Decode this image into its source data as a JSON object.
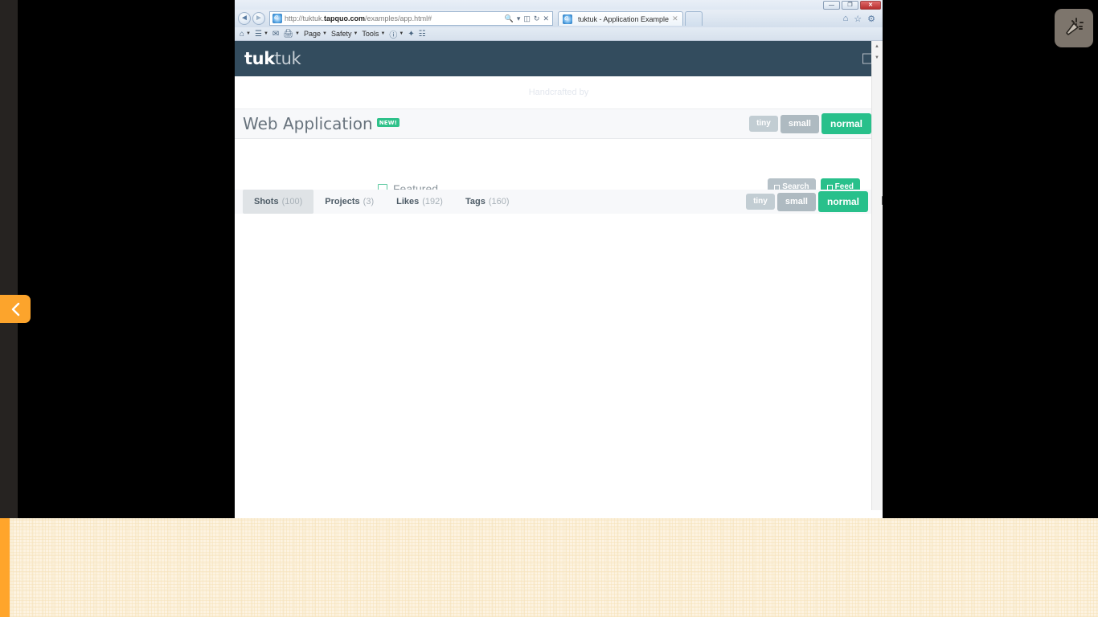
{
  "browser": {
    "window_controls": {
      "minimize": "—",
      "restore": "❐",
      "close": "✕"
    },
    "back_label": "◄",
    "forward_label": "►",
    "address": {
      "scheme": "http://tuktuk.",
      "domain": "tapquo.com",
      "path": "/examples/app.html#"
    },
    "address_icons": [
      "search-icon",
      "compat-view-icon",
      "refresh-icon",
      "stop-icon"
    ],
    "tab_title": "tuktuk - Application Example",
    "tab_close": "✕",
    "new_tab_label": "",
    "chrome_icons": [
      "home-icon",
      "favorites-icon",
      "tools-gear-icon"
    ],
    "command_bar": [
      {
        "icon": "home-icon",
        "label": "",
        "caret": true
      },
      {
        "icon": "feeds-icon",
        "label": "",
        "caret": true
      },
      {
        "icon": "mail-icon",
        "label": "",
        "caret": false
      },
      {
        "icon": "print-icon",
        "label": "",
        "caret": true
      },
      {
        "icon": "",
        "label": "Page",
        "caret": true
      },
      {
        "icon": "",
        "label": "Safety",
        "caret": true
      },
      {
        "icon": "",
        "label": "Tools",
        "caret": true
      },
      {
        "icon": "help-icon",
        "label": "",
        "caret": true
      },
      {
        "icon": "addon-icon",
        "label": "",
        "caret": false
      },
      {
        "icon": "signal-icon",
        "label": "",
        "caret": false
      }
    ]
  },
  "app": {
    "brand": {
      "bold": "tuk",
      "light": "tuk"
    },
    "navbar_toggle": "menu-toggle",
    "handcrafted": "Handcrafted by",
    "title": "Web Application",
    "badge": "NEW!",
    "size_buttons": [
      {
        "label": "tiny",
        "active": false
      },
      {
        "label": "small",
        "active": false
      },
      {
        "label": "normal",
        "active": true
      }
    ],
    "featured": {
      "label": "Featured",
      "checked": false
    },
    "clipped_buttons": [
      {
        "label": "Search",
        "style": "gray"
      },
      {
        "label": "Feed",
        "style": "green"
      }
    ],
    "tabs": [
      {
        "label": "Shots",
        "count": "(100)",
        "active": true
      },
      {
        "label": "Projects",
        "count": "(3)",
        "active": false
      },
      {
        "label": "Likes",
        "count": "(192)",
        "active": false
      },
      {
        "label": "Tags",
        "count": "(160)",
        "active": false
      }
    ],
    "tab_size_buttons": [
      {
        "label": "tiny",
        "active": false
      },
      {
        "label": "small",
        "active": false
      },
      {
        "label": "normal",
        "active": true
      }
    ]
  },
  "desktop": {
    "pull_tab": "chevron-left-icon",
    "tool_widget": "magic-wand-icon"
  },
  "colors": {
    "navbar": "#334c5e",
    "accent_green": "#28c08b",
    "orange": "#fca42c",
    "gray_button": "#c2cdd3",
    "paper": "#fdf3e1"
  }
}
